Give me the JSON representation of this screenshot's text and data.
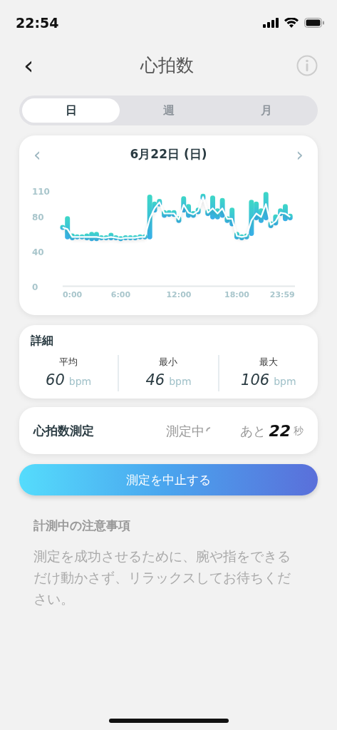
{
  "status_bar": {
    "time": "22:54"
  },
  "header": {
    "back": "‹",
    "title": "心拍数"
  },
  "tabs": [
    {
      "label": "日",
      "selected": true
    },
    {
      "label": "週",
      "selected": false
    },
    {
      "label": "月",
      "selected": false
    }
  ],
  "chart_card": {
    "prev": "‹",
    "date": "6月22日 (日)",
    "next": "›",
    "chart_data": {
      "type": "line",
      "ylim": [
        0,
        110
      ],
      "yticks": [
        0,
        40,
        80,
        110
      ],
      "xlim": [
        0,
        24
      ],
      "xticks": [
        {
          "value": 0,
          "label": "0:00"
        },
        {
          "value": 6,
          "label": "6:00"
        },
        {
          "value": 12,
          "label": "12:00"
        },
        {
          "value": 18,
          "label": "18:00"
        },
        {
          "value": 23.98,
          "label": "23:59"
        }
      ],
      "x": [
        0,
        0.5,
        1,
        1.5,
        2,
        2.5,
        3,
        3.5,
        4,
        4.5,
        5,
        5.5,
        6,
        6.5,
        7,
        7.5,
        8,
        8.5,
        9,
        9.5,
        10,
        10.5,
        11,
        11.5,
        12,
        12.5,
        13,
        13.5,
        14,
        14.5,
        15,
        15.5,
        16,
        16.5,
        17,
        17.5,
        18,
        18.5,
        19,
        19.5,
        20,
        20.5,
        21,
        21.5,
        22,
        22.5,
        23,
        23.5
      ],
      "values": [
        68,
        66,
        57,
        57,
        57,
        57,
        57,
        57,
        56,
        56,
        57,
        56,
        55,
        56,
        56,
        56,
        57,
        57,
        78,
        90,
        97,
        84,
        84,
        84,
        77,
        94,
        85,
        83,
        87,
        103,
        85,
        90,
        84,
        90,
        78,
        78,
        58,
        57,
        58,
        76,
        84,
        80,
        95,
        71,
        75,
        85,
        84,
        80
      ]
    }
  },
  "details": {
    "title": "詳細",
    "stats": [
      {
        "label": "平均",
        "value": "60",
        "unit": "bpm"
      },
      {
        "label": "最小",
        "value": "46",
        "unit": "bpm"
      },
      {
        "label": "最大",
        "value": "106",
        "unit": "bpm"
      }
    ]
  },
  "measurement": {
    "title": "心拍数測定",
    "status": "測定中",
    "remaining_prefix": "あと",
    "remaining": "22",
    "unit": "秒"
  },
  "stop_button": "測定を中止する",
  "notes": {
    "title": "計測中の注意事項",
    "body": "測定を成功させるために、腕や指をできるだけ動かさず、リラックスしてお待ちください。"
  }
}
